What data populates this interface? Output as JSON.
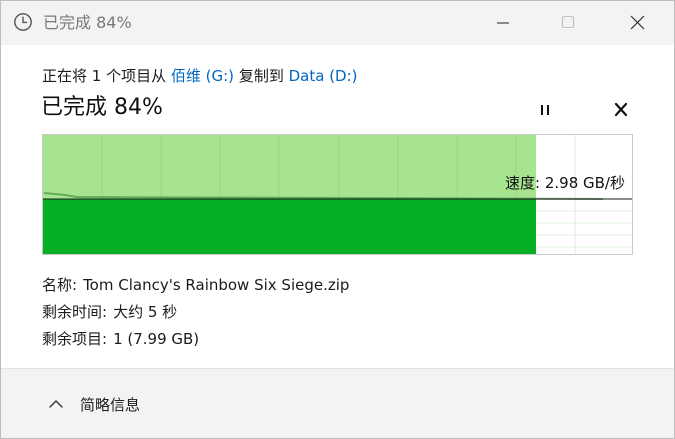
{
  "window": {
    "title": "已完成 84%"
  },
  "transfer": {
    "prefix": "正在将 1 个项目从",
    "source": "佰维 (G:)",
    "middle": "复制到",
    "destination": "Data (D:)",
    "status": "已完成 84%",
    "progress_percent": 84,
    "speed": "速度: 2.98 GB/秒"
  },
  "details": {
    "name_label": "名称:",
    "name_value": "Tom Clancy's Rainbow Six Siege.zip",
    "time_label": "剩余时间:",
    "time_value": "大约 5 秒",
    "items_label": "剩余项目:",
    "items_value": "1 (7.99 GB)"
  },
  "footer": {
    "less_info_label": "简略信息"
  },
  "icons": {
    "title": "clock-icon",
    "minimize": "minimize-icon",
    "maximize": "maximize-icon",
    "close": "close-icon",
    "pause": "pause-icon",
    "cancel": "cancel-icon",
    "collapse": "chevron-up-icon"
  },
  "colors": {
    "progress_fill": "#06b025",
    "progress_light": "#a7e48f",
    "link": "#0067c0"
  }
}
